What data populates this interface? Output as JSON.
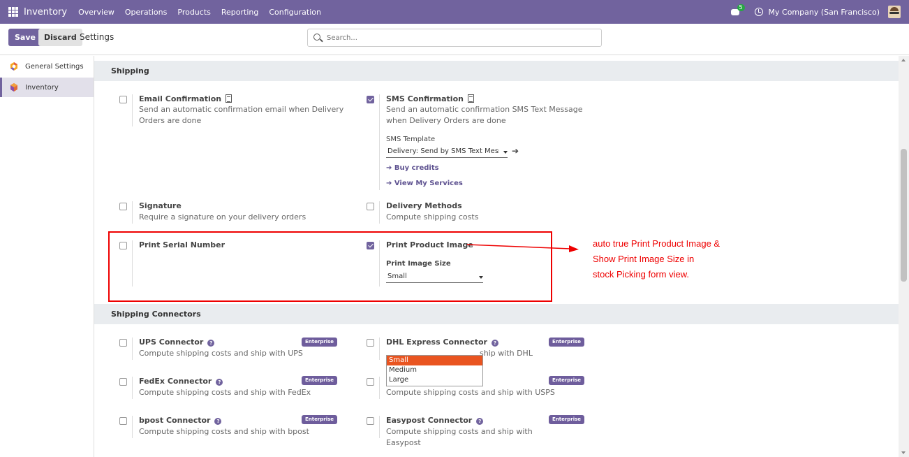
{
  "navbar": {
    "brand": "Inventory",
    "menu": [
      "Overview",
      "Operations",
      "Products",
      "Reporting",
      "Configuration"
    ],
    "chat_badge": "5",
    "company": "My Company (San Francisco)"
  },
  "control": {
    "save_label": "Save",
    "discard_label": "Discard",
    "title": "Settings",
    "search_placeholder": "Search..."
  },
  "sidebar": {
    "items": [
      {
        "label": "General Settings",
        "icon": "odoo-icon"
      },
      {
        "label": "Inventory",
        "icon": "inventory-icon",
        "active": true
      }
    ]
  },
  "shipping": {
    "heading": "Shipping",
    "email_confirmation": {
      "title": "Email Confirmation",
      "desc": "Send an automatic confirmation email when Delivery Orders are done",
      "checked": false
    },
    "sms_confirmation": {
      "title": "SMS Confirmation",
      "desc": "Send an automatic confirmation SMS Text Message when Delivery Orders are done",
      "checked": true
    },
    "sms_template_label": "SMS Template",
    "sms_template_value": "Delivery: Send by SMS Text Messa",
    "buy_credits": "➔ Buy credits",
    "view_services": "➔ View My Services",
    "signature": {
      "title": "Signature",
      "desc": "Require a signature on your delivery orders",
      "checked": false
    },
    "delivery_methods": {
      "title": "Delivery Methods",
      "desc": "Compute shipping costs",
      "checked": false
    },
    "print_serial": {
      "title": "Print Serial Number",
      "checked": false
    },
    "print_product_image": {
      "title": "Print Product Image",
      "checked": true
    },
    "print_image_size_label": "Print Image Size",
    "print_image_size_value": "Small",
    "size_options": [
      "Small",
      "Medium",
      "Large"
    ]
  },
  "connectors": {
    "heading": "Shipping Connectors",
    "badge": "Enterprise",
    "ups": {
      "title": "UPS Connector",
      "desc": "Compute shipping costs and ship with UPS"
    },
    "dhl": {
      "title": "DHL Express Connector",
      "desc": "Compute shipping costs and ship with DHL",
      "desc_visible": "ship with DHL"
    },
    "fedex": {
      "title": "FedEx Connector",
      "desc": "Compute shipping costs and ship with FedEx"
    },
    "usps": {
      "desc": "Compute shipping costs and ship with USPS"
    },
    "bpost": {
      "title": "bpost Connector",
      "desc": "Compute shipping costs and ship with bpost"
    },
    "easypost": {
      "title": "Easypost Connector",
      "desc": "Compute shipping costs and ship with Easypost"
    }
  },
  "annotation": {
    "lines": [
      "auto true Print Product Image &",
      "Show Print Image Size in",
      "stock Picking form view."
    ],
    "color": "#e00000"
  },
  "colors": {
    "brand": "#71639e",
    "highlight": "#e95420"
  }
}
